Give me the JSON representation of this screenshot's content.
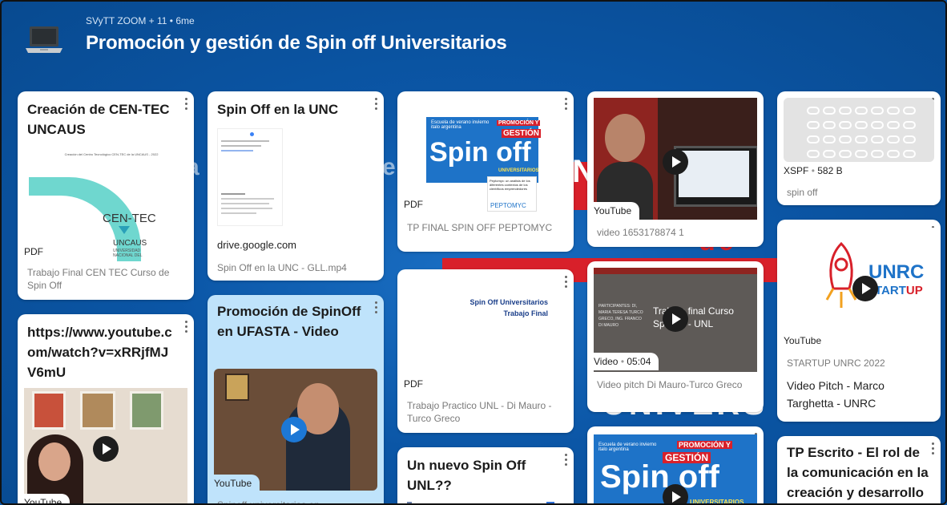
{
  "header": {
    "meta": "SVyTT ZOOM + 11 • 6me",
    "title": "Promoción y gestión de Spin off Universitarios"
  },
  "background_words": {
    "word1": "a",
    "word2": "e",
    "word3": "de",
    "word4": "UNIVERS",
    "word5": "N"
  },
  "cards": {
    "c1": {
      "title": "Creación de CEN-TEC UNCAUS",
      "doc_heading": "Creación del Centro Tecnológico CEN-TEC de la UNCAUS - 2022",
      "logo_main": "CEN-TEC",
      "logo_sub": "UNCAUS",
      "logo_small": "UNIVERSIDAD NACIONAL DEL",
      "tag": "PDF",
      "caption": "Trabajo Final CEN TEC Curso de Spin Off"
    },
    "c2": {
      "title": "https://www.youtube.com/watch?v=xRRjfMJV6mU",
      "tag": "YouTube"
    },
    "c3": {
      "title": "Spin Off en la UNC",
      "domain": "drive.google.com",
      "caption": "Spin Off en la UNC - GLL.mp4"
    },
    "c4": {
      "title": "Promoción de SpinOff en UFASTA - Video",
      "tag": "YouTube",
      "caption": "Spinoff universitarias en"
    },
    "c5": {
      "flyer_top": "Escuela de verano invierno italo argentina",
      "flyer_promo": "PROMOCIÓN Y",
      "flyer_gestion": "GESTIÓN",
      "flyer_big": "Spin off",
      "flyer_univ": "UNIVERSITARIOS",
      "flyer_note": "Peptomyc: un análisis de los diferentes contextos de los científicos emprendedores",
      "flyer_logo": "PEPTOMYC",
      "tag": "PDF",
      "caption": "TP FINAL SPIN OFF PEPTOMYC"
    },
    "c6": {
      "doc_line1": "Spin Off Universitarios",
      "doc_line2": "Trabajo Final",
      "tag": "PDF",
      "caption": "Trabajo Practico UNL - Di Mauro - Turco Greco"
    },
    "c7": {
      "title": "Un nuevo Spin Off UNL??"
    },
    "c8": {
      "tag": "YouTube",
      "caption": "video 1653178874 1"
    },
    "c9": {
      "slide_left": "PARTICIPANTES: DI, MARIA TERESA TURCO GRECO, ING. FRANCO DI MAURO",
      "slide_title": "Trabajo final Curso Spin off - UNL",
      "tag": "Video",
      "duration": "05:04",
      "caption": "Video pitch Di Mauro-Turco Greco"
    },
    "c10": {
      "flyer_top": "Escuela de verano invierno italo argentina",
      "flyer_promo": "PROMOCIÓN Y",
      "flyer_gestion": "GESTIÓN",
      "flyer_big": "Spin off",
      "flyer_univ": "UNIVERSITARIOS"
    },
    "c11": {
      "tag": "XSPF",
      "size": "582 B",
      "caption": "spin off"
    },
    "c12": {
      "logo_unrc": "UNRC",
      "logo_start": "START",
      "logo_up": "UP",
      "tag": "YouTube",
      "caption": "STARTUP UNRC 2022",
      "title": "Video Pitch - Marco Targhetta - UNRC"
    },
    "c13": {
      "title": "TP Escrito - El rol de la comunicación en la creación y desarrollo"
    }
  },
  "colors": {
    "background": "#0b56a6",
    "card": "#ffffff",
    "card_highlight": "#bfe3fb",
    "accent_red": "#d8202a",
    "play_blue": "#1d78d6"
  },
  "icons": [
    "laptop-icon",
    "kebab-menu-icon",
    "play-icon"
  ]
}
